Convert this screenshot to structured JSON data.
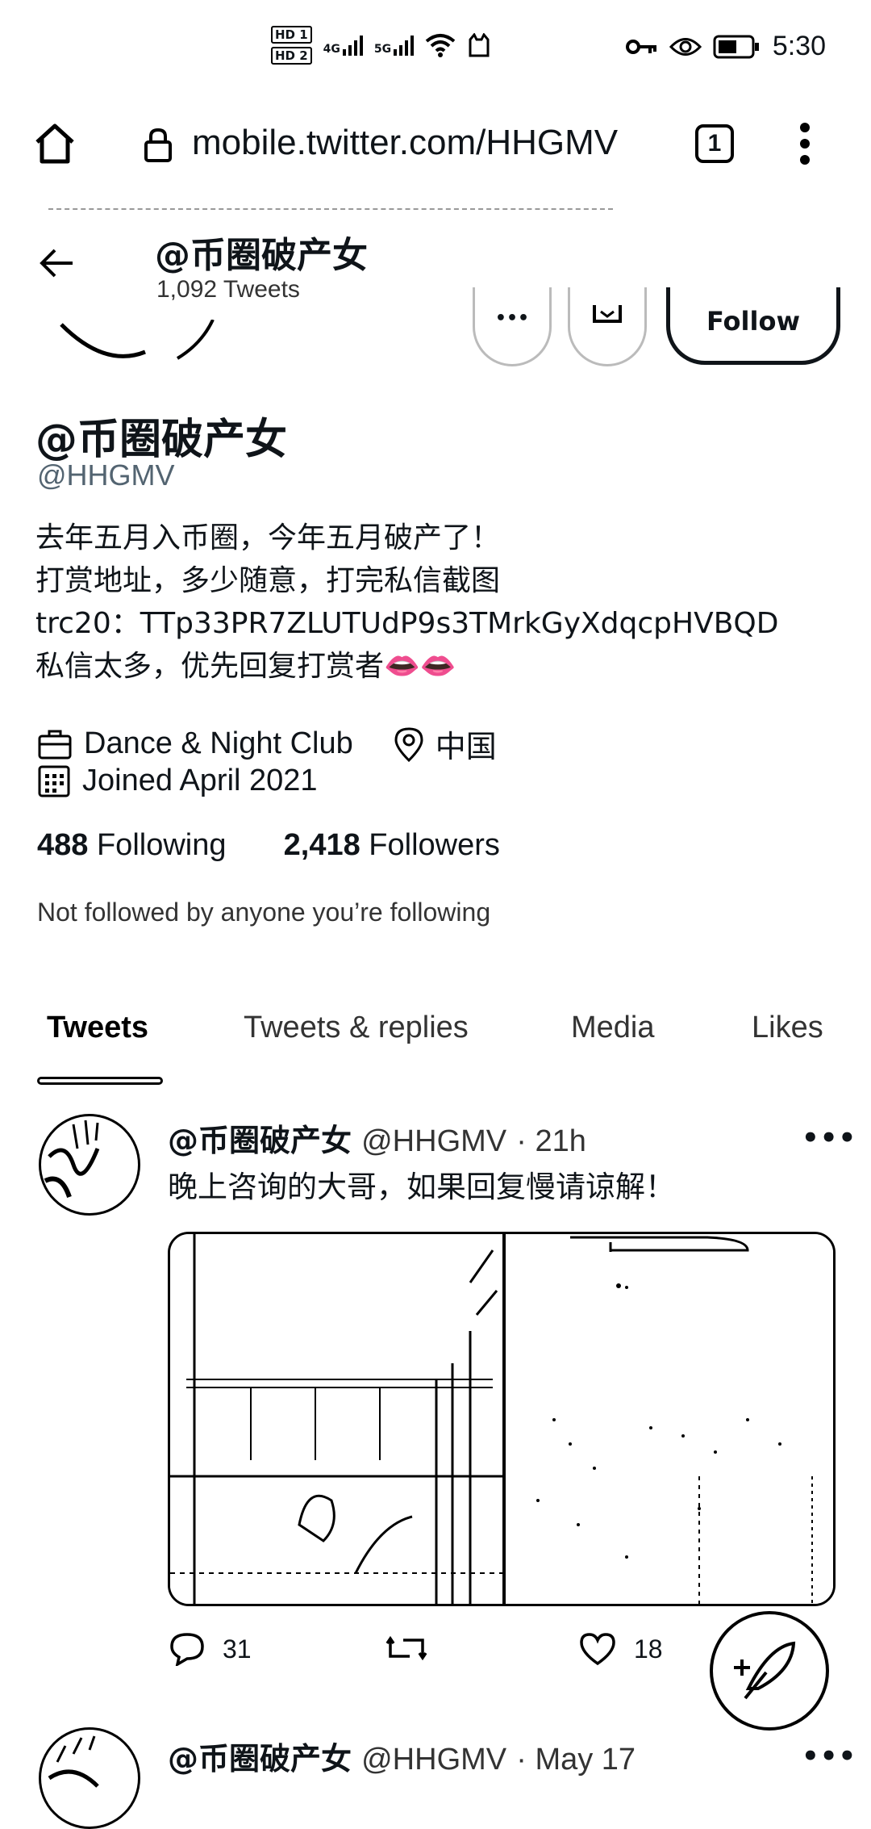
{
  "status_bar": {
    "hd_badges": [
      "HD 1",
      "HD 2"
    ],
    "network_1": "4G",
    "network_2": "5G",
    "time": "5:30"
  },
  "browser": {
    "url": "mobile.twitter.com/HHGMV",
    "tab_count": "1"
  },
  "header": {
    "name": "@币圈破产女",
    "tweet_count": "1,092 Tweets"
  },
  "profile": {
    "follow_label": "Follow",
    "name": "@币圈破产女",
    "handle": "@HHGMV",
    "bio_lines": [
      "去年五月入币圈，今年五月破产了！",
      "打赏地址，多少随意，打完私信截图",
      "trc20：TTp33PR7ZLUTUdP9s3TMrkGyXdqcpHVBQD",
      "私信太多，优先回复打赏者👄👄"
    ],
    "category": "Dance & Night Club",
    "location": "中国",
    "joined": "Joined April 2021",
    "following_count": "488",
    "following_label": "Following",
    "followers_count": "2,418",
    "followers_label": "Followers",
    "not_followed": "Not followed by anyone you’re following"
  },
  "tabs": [
    {
      "label": "Tweets",
      "active": true
    },
    {
      "label": "Tweets & replies",
      "active": false
    },
    {
      "label": "Media",
      "active": false
    },
    {
      "label": "Likes",
      "active": false
    }
  ],
  "tweets": [
    {
      "name": "@币圈破产女",
      "handle": "@HHGMV",
      "time": "· 21h",
      "text": "晚上咨询的大哥，如果回复慢请谅解！",
      "replies": "31",
      "retweets": "",
      "likes": "18"
    },
    {
      "name": "@币圈破产女",
      "handle": "@HHGMV",
      "time": "· May 17"
    }
  ],
  "more_glyph": "•••",
  "icons": [
    "home-icon",
    "lock-icon",
    "kebab-menu-icon",
    "back-arrow-icon",
    "briefcase-icon",
    "location-pin-icon",
    "calendar-icon",
    "reply-icon",
    "retweet-icon",
    "heart-icon",
    "compose-feather-icon",
    "key-icon",
    "eye-icon",
    "battery-icon",
    "wifi-icon"
  ],
  "colors": {
    "text": "#0f1419",
    "secondary": "#536471",
    "background": "#ffffff"
  }
}
